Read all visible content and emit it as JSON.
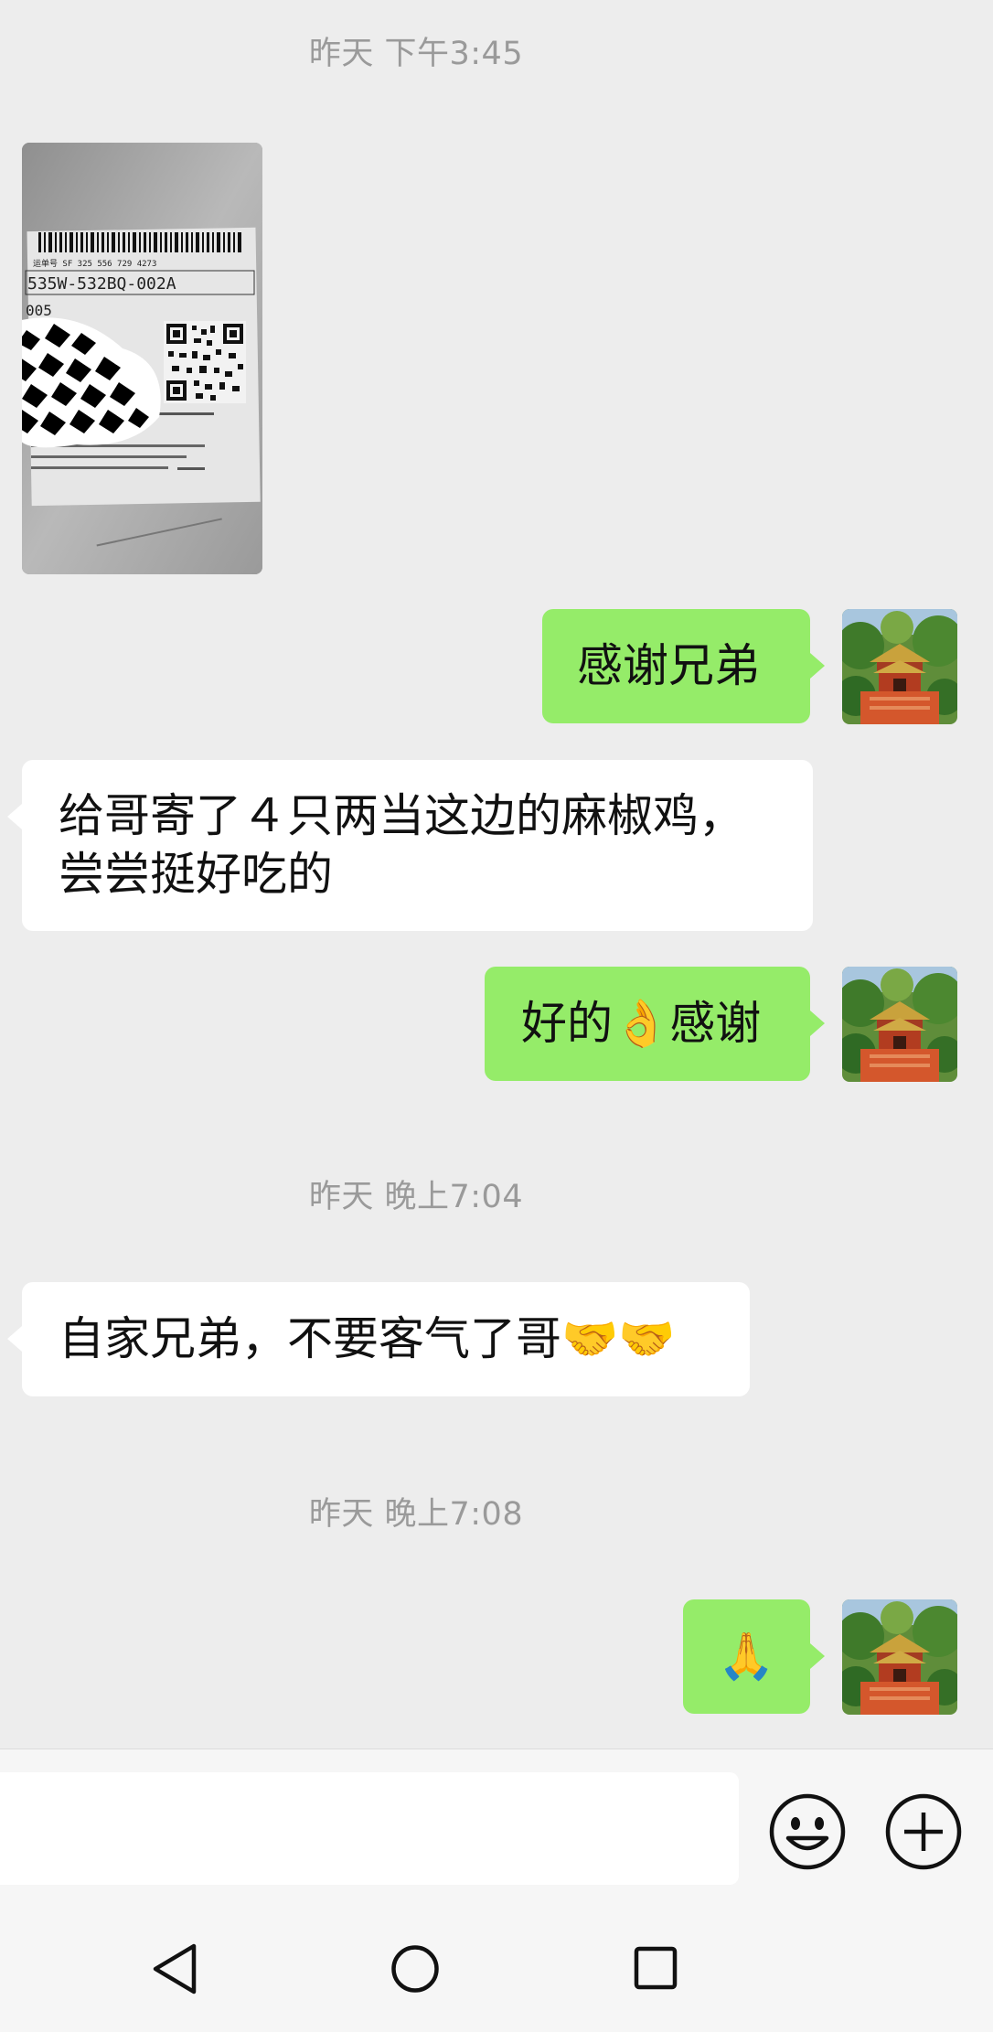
{
  "timestamps": [
    "昨天 下午3:45",
    "昨天 晚上7:04",
    "昨天 晚上7:08"
  ],
  "photo_message": {
    "label_lines": [
      "运单号 SF 325 556 729 4273",
      "535W-532BQ-002A",
      "005"
    ]
  },
  "messages": {
    "m1": "感谢兄弟",
    "m2_line1": "给哥寄了４只两当这边的麻椒鸡，",
    "m2_line2": "尝尝挺好吃的",
    "m3_pre": "好的",
    "m3_emoji": "👌",
    "m3_post": "感谢",
    "m4_text": "自家兄弟，不要客气了哥",
    "m4_emoji": "🤝🤝",
    "m5_emoji": "🙏"
  },
  "input": {
    "value": ""
  },
  "icons": {
    "emoji_button": "smiley-icon",
    "plus_button": "plus-circle-icon",
    "nav_back": "triangle-back-icon",
    "nav_home": "circle-home-icon",
    "nav_recents": "square-recents-icon"
  },
  "colors": {
    "my_bubble": "#95ec69",
    "other_bubble": "#ffffff",
    "background": "#ededed",
    "timestamp": "#9a9a9a"
  }
}
